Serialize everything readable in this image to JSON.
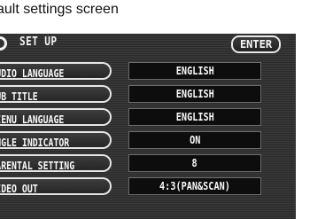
{
  "caption": "ault settings screen",
  "header": {
    "title": "SET UP",
    "enter_label": "ENTER"
  },
  "settings": [
    {
      "label": "UDIO LANGUAGE",
      "value": "ENGLISH"
    },
    {
      "label": "UB TITLE",
      "value": "ENGLISH"
    },
    {
      "label": "IENU LANGUAGE",
      "value": "ENGLISH"
    },
    {
      "label": "NGLE INDICATOR",
      "value": "ON"
    },
    {
      "label": "ARENTAL SETTING",
      "value": "8"
    },
    {
      "label": "IDEO OUT",
      "value": "4:3(PAN&SCAN)"
    }
  ]
}
